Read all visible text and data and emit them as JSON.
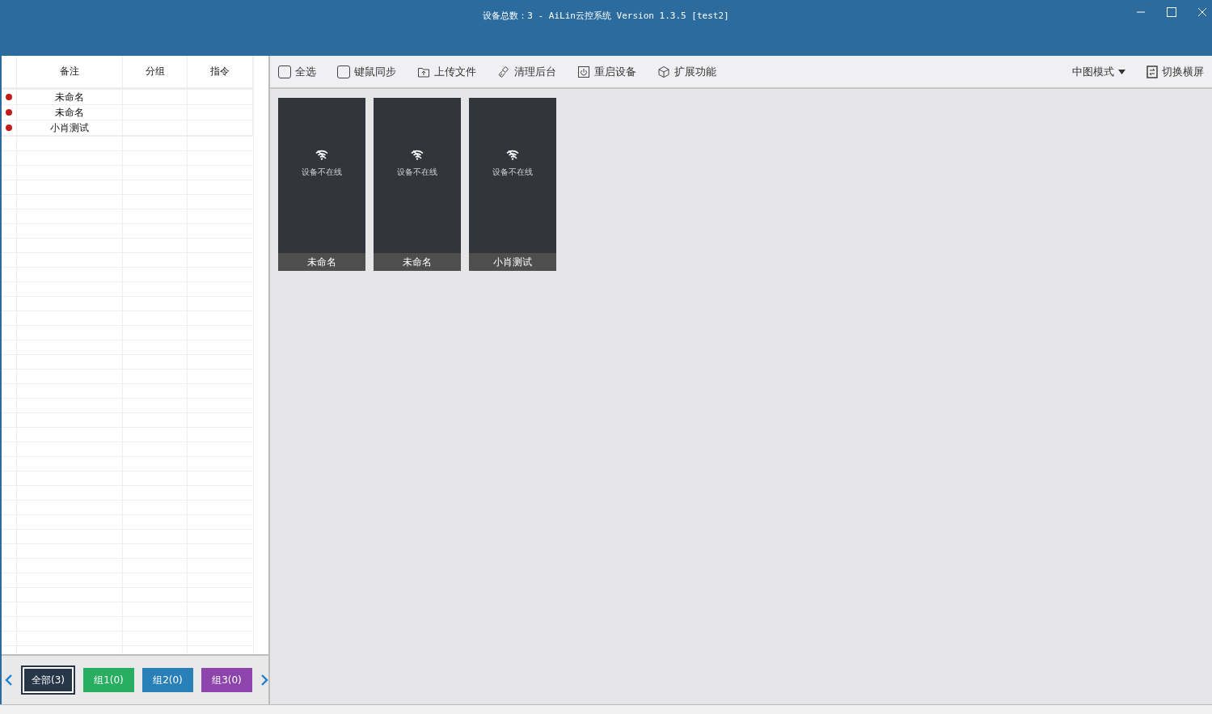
{
  "window": {
    "title": "设备总数：3 - AiLin云控系统 Version 1.3.5 [test2]"
  },
  "table": {
    "columns": [
      "备注",
      "分组",
      "指令"
    ],
    "rows": [
      {
        "online": false,
        "cells": [
          "未命名",
          "",
          ""
        ]
      },
      {
        "online": false,
        "cells": [
          "未命名",
          "",
          ""
        ]
      },
      {
        "online": false,
        "cells": [
          "小肖测试",
          "",
          ""
        ]
      }
    ]
  },
  "groups": [
    {
      "label": "全部(3)",
      "selected": true,
      "color": "#263548"
    },
    {
      "label": "组1(0)",
      "selected": false,
      "color": "#27ae60"
    },
    {
      "label": "组2(0)",
      "selected": false,
      "color": "#2980b9"
    },
    {
      "label": "组3(0)",
      "selected": false,
      "color": "#8e44ad"
    }
  ],
  "toolbar": [
    {
      "kind": "checkbox",
      "label": "全选",
      "checked": false
    },
    {
      "kind": "checkbox",
      "label": "键鼠同步",
      "checked": false
    },
    {
      "kind": "upload",
      "label": "上传文件"
    },
    {
      "kind": "clean",
      "label": "清理后台"
    },
    {
      "kind": "power",
      "label": "重启设备"
    },
    {
      "kind": "cube",
      "label": "扩展功能"
    }
  ],
  "view_mode": {
    "label": "中图模式"
  },
  "orientation_button": {
    "label": "切换横屏"
  },
  "devices": [
    {
      "name": "未命名",
      "online": false,
      "status": "设备不在线"
    },
    {
      "name": "未命名",
      "online": false,
      "status": "设备不在线"
    },
    {
      "name": "小肖测试",
      "online": false,
      "status": "设备不在线"
    }
  ]
}
